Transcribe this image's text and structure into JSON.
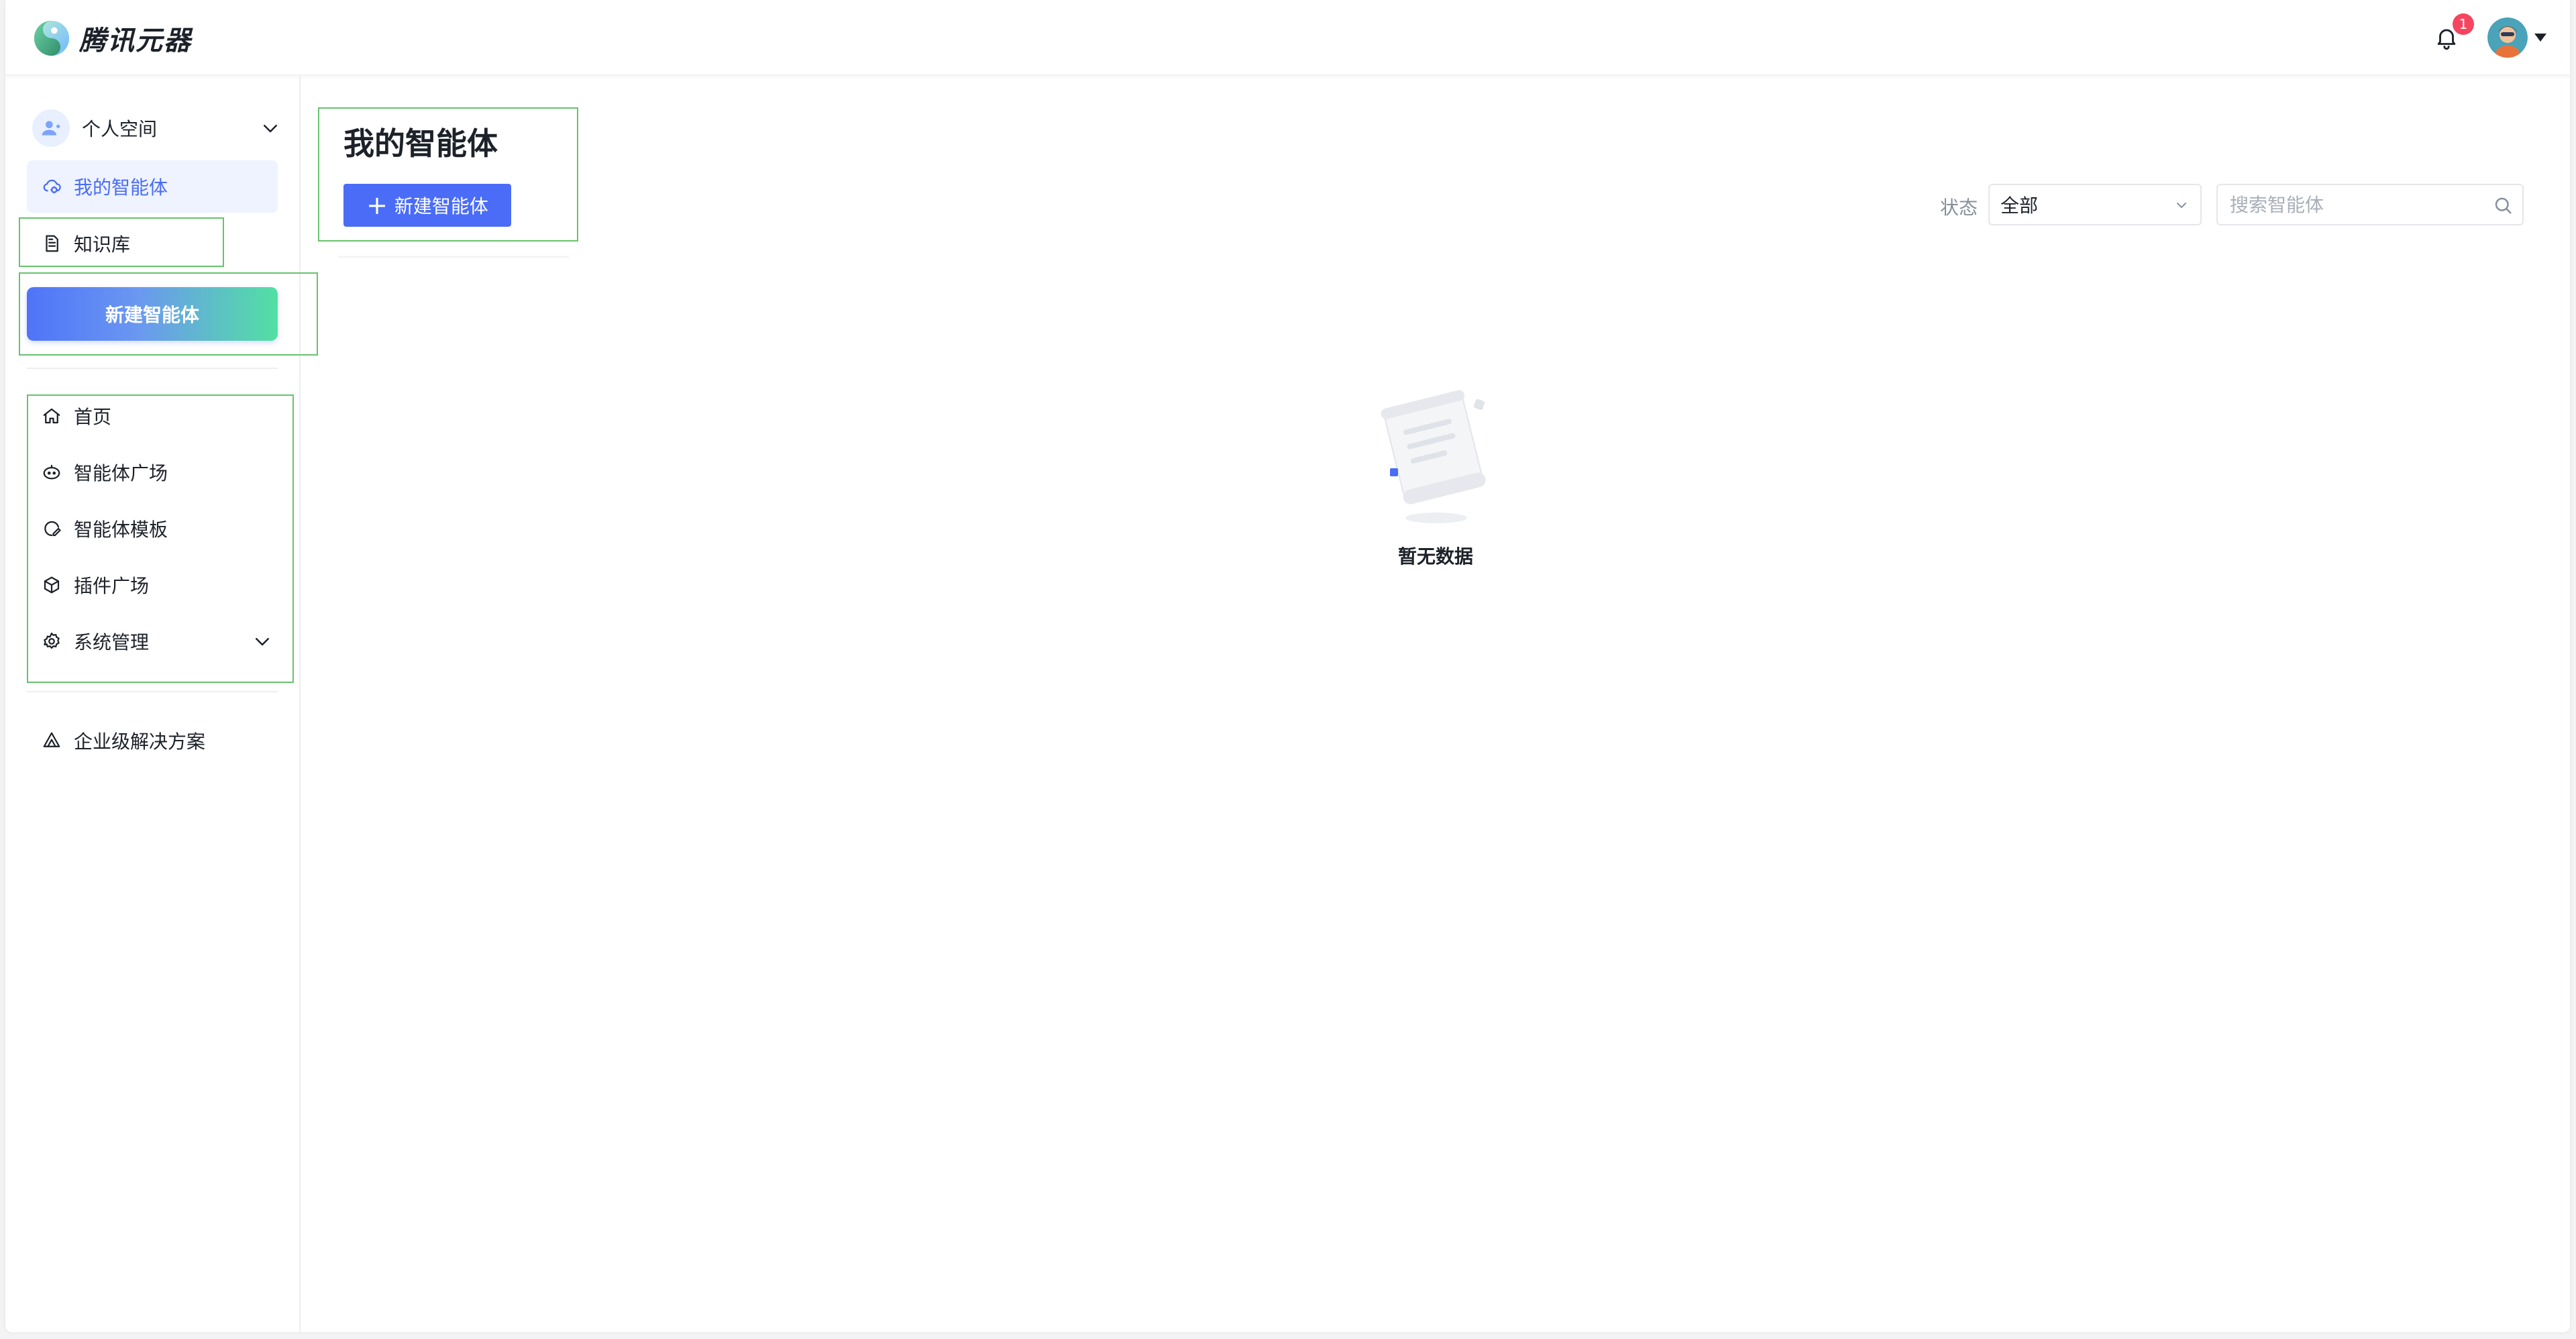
{
  "app": {
    "brand_name": "腾讯元器",
    "notification_count": "1"
  },
  "sidebar": {
    "space_label": "个人空间",
    "workspace_items": [
      {
        "label": "我的智能体",
        "icon": "agent-cloud-icon",
        "active": true
      },
      {
        "label": "知识库",
        "icon": "document-icon",
        "active": false
      }
    ],
    "create_button_label": "新建智能体",
    "menu_items": [
      {
        "label": "首页",
        "icon": "home-icon"
      },
      {
        "label": "智能体广场",
        "icon": "robot-icon"
      },
      {
        "label": "智能体模板",
        "icon": "template-icon"
      },
      {
        "label": "插件广场",
        "icon": "cube-icon"
      },
      {
        "label": "系统管理",
        "icon": "gear-icon",
        "expandable": true
      }
    ],
    "enterprise_label": "企业级解决方案"
  },
  "main": {
    "title": "我的智能体",
    "new_agent_button_label": "新建智能体",
    "filter": {
      "status_label": "状态",
      "status_value": "全部",
      "search_placeholder": "搜索智能体"
    },
    "empty_text": "暂无数据"
  },
  "colors": {
    "primary": "#4a6cf7",
    "active_bg": "#eef3ff",
    "gradient_start": "#4f74f9",
    "gradient_end": "#52e0a2",
    "badge": "#f5455f",
    "highlight_box": "#67c26e"
  }
}
